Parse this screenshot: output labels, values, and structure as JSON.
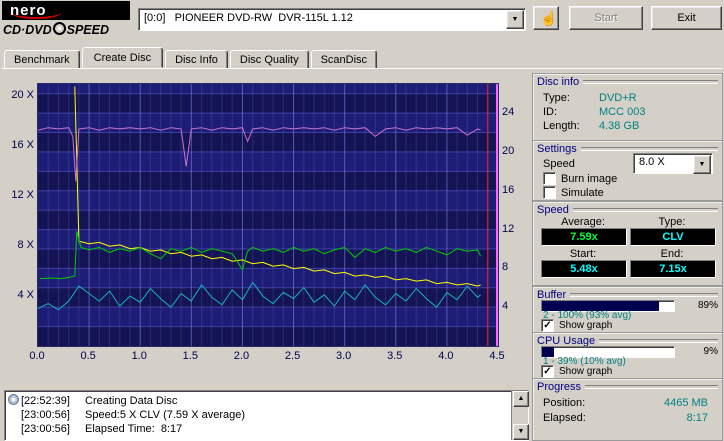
{
  "window": {
    "brand": {
      "logo_text": "nero",
      "logo_sub1": "CD·DVD",
      "logo_sub2": "SPEED"
    },
    "drive_selector": {
      "value": "[0:0]   PIONEER DVD-RW  DVR-115L 1.12"
    },
    "buttons": {
      "start": "Start",
      "exit": "Exit"
    }
  },
  "tabs": [
    {
      "label": "Benchmark"
    },
    {
      "label": "Create Disc"
    },
    {
      "label": "Disc Info"
    },
    {
      "label": "Disc Quality"
    },
    {
      "label": "ScanDisc"
    }
  ],
  "chart_data": {
    "type": "line",
    "xlim": [
      0,
      4.5
    ],
    "x_ticks": [
      {
        "v": 0.0,
        "label": "0.0"
      },
      {
        "v": 0.5,
        "label": "0.5"
      },
      {
        "v": 1.0,
        "label": "1.0"
      },
      {
        "v": 1.5,
        "label": "1.5"
      },
      {
        "v": 2.0,
        "label": "2.0"
      },
      {
        "v": 2.5,
        "label": "2.5"
      },
      {
        "v": 3.0,
        "label": "3.0"
      },
      {
        "v": 3.5,
        "label": "3.5"
      },
      {
        "v": 4.0,
        "label": "4.0"
      },
      {
        "v": 4.5,
        "label": "4.5"
      }
    ],
    "left_axis": {
      "max": 21,
      "ticks": [
        {
          "v": 20,
          "label": "20 X"
        },
        {
          "v": 16,
          "label": "16 X"
        },
        {
          "v": 12,
          "label": "12 X"
        },
        {
          "v": 8,
          "label": "8 X"
        },
        {
          "v": 4,
          "label": "4 X"
        }
      ]
    },
    "right_axis": {
      "max": 27,
      "ticks": [
        {
          "v": 24,
          "label": "24"
        },
        {
          "v": 20,
          "label": "20"
        },
        {
          "v": 16,
          "label": "16"
        },
        {
          "v": 12,
          "label": "12"
        },
        {
          "v": 8,
          "label": "8"
        },
        {
          "v": 4,
          "label": "4"
        }
      ]
    },
    "marker": {
      "x": 4.4,
      "color": "#ff2222"
    },
    "right_edge_color": "#ff66ff",
    "series": [
      {
        "name": "cpu-usage",
        "color": "#19b3b3",
        "points": [
          [
            0.0,
            3.0
          ],
          [
            0.1,
            3.4
          ],
          [
            0.2,
            2.9
          ],
          [
            0.3,
            3.6
          ],
          [
            0.4,
            4.8
          ],
          [
            0.5,
            4.2
          ],
          [
            0.6,
            3.6
          ],
          [
            0.7,
            4.4
          ],
          [
            0.8,
            3.2
          ],
          [
            0.9,
            4.0
          ],
          [
            1.0,
            3.5
          ],
          [
            1.1,
            4.6
          ],
          [
            1.2,
            3.8
          ],
          [
            1.3,
            3.1
          ],
          [
            1.4,
            4.2
          ],
          [
            1.5,
            3.6
          ],
          [
            1.6,
            4.9
          ],
          [
            1.7,
            3.9
          ],
          [
            1.8,
            3.3
          ],
          [
            1.9,
            4.5
          ],
          [
            2.0,
            3.7
          ],
          [
            2.1,
            5.1
          ],
          [
            2.2,
            4.0
          ],
          [
            2.3,
            3.4
          ],
          [
            2.4,
            4.3
          ],
          [
            2.5,
            3.8
          ],
          [
            2.6,
            4.7
          ],
          [
            2.7,
            3.5
          ],
          [
            2.8,
            4.1
          ],
          [
            2.9,
            3.2
          ],
          [
            3.0,
            4.4
          ],
          [
            3.1,
            3.7
          ],
          [
            3.2,
            4.9
          ],
          [
            3.3,
            3.9
          ],
          [
            3.4,
            3.3
          ],
          [
            3.5,
            4.2
          ],
          [
            3.6,
            3.6
          ],
          [
            3.7,
            4.6
          ],
          [
            3.8,
            3.8
          ],
          [
            3.9,
            3.1
          ],
          [
            4.0,
            4.3
          ],
          [
            4.1,
            3.7
          ],
          [
            4.2,
            4.8
          ],
          [
            4.3,
            3.9
          ],
          [
            4.33,
            4.1
          ]
        ]
      },
      {
        "name": "speed-secondary",
        "color": "#ffff00",
        "points": [
          [
            0.36,
            20.8
          ],
          [
            0.4,
            8.4
          ],
          [
            0.5,
            8.2
          ],
          [
            0.6,
            8.3
          ],
          [
            0.7,
            8.0
          ],
          [
            0.8,
            8.1
          ],
          [
            0.9,
            7.8
          ],
          [
            1.0,
            7.9
          ],
          [
            1.1,
            7.6
          ],
          [
            1.2,
            7.7
          ],
          [
            1.3,
            7.4
          ],
          [
            1.4,
            7.5
          ],
          [
            1.5,
            7.2
          ],
          [
            1.6,
            7.3
          ],
          [
            1.7,
            7.0
          ],
          [
            1.8,
            7.1
          ],
          [
            1.9,
            6.8
          ],
          [
            2.0,
            6.9
          ],
          [
            2.1,
            6.6
          ],
          [
            2.2,
            6.7
          ],
          [
            2.3,
            6.4
          ],
          [
            2.4,
            6.5
          ],
          [
            2.5,
            6.2
          ],
          [
            2.6,
            6.3
          ],
          [
            2.7,
            6.0
          ],
          [
            2.8,
            6.1
          ],
          [
            2.9,
            5.8
          ],
          [
            3.0,
            5.9
          ],
          [
            3.1,
            5.6
          ],
          [
            3.2,
            5.7
          ],
          [
            3.3,
            5.5
          ],
          [
            3.4,
            5.6
          ],
          [
            3.5,
            5.3
          ],
          [
            3.6,
            5.4
          ],
          [
            3.7,
            5.2
          ],
          [
            3.8,
            5.3
          ],
          [
            3.9,
            5.0
          ],
          [
            4.0,
            5.1
          ],
          [
            4.1,
            4.9
          ],
          [
            4.2,
            5.0
          ],
          [
            4.3,
            4.8
          ],
          [
            4.33,
            4.9
          ]
        ]
      },
      {
        "name": "write-speed",
        "color": "#00cc00",
        "points": [
          [
            0.02,
            5.4
          ],
          [
            0.12,
            5.45
          ],
          [
            0.22,
            5.4
          ],
          [
            0.3,
            5.5
          ],
          [
            0.36,
            5.6
          ],
          [
            0.38,
            9.2
          ],
          [
            0.42,
            7.9
          ],
          [
            0.5,
            7.7
          ],
          [
            0.6,
            7.9
          ],
          [
            0.7,
            7.5
          ],
          [
            0.8,
            7.8
          ],
          [
            0.9,
            7.6
          ],
          [
            1.0,
            7.9
          ],
          [
            1.1,
            7.4
          ],
          [
            1.2,
            7.0
          ],
          [
            1.3,
            7.8
          ],
          [
            1.4,
            7.6
          ],
          [
            1.5,
            7.9
          ],
          [
            1.6,
            7.5
          ],
          [
            1.7,
            7.8
          ],
          [
            1.8,
            7.6
          ],
          [
            1.9,
            7.4
          ],
          [
            1.95,
            6.8
          ],
          [
            2.0,
            6.1
          ],
          [
            2.05,
            7.6
          ],
          [
            2.1,
            7.9
          ],
          [
            2.2,
            7.6
          ],
          [
            2.3,
            7.8
          ],
          [
            2.4,
            7.5
          ],
          [
            2.5,
            7.9
          ],
          [
            2.6,
            7.6
          ],
          [
            2.7,
            7.8
          ],
          [
            2.8,
            7.4
          ],
          [
            2.9,
            7.7
          ],
          [
            3.0,
            7.9
          ],
          [
            3.1,
            7.1
          ],
          [
            3.2,
            7.8
          ],
          [
            3.3,
            7.5
          ],
          [
            3.4,
            7.9
          ],
          [
            3.5,
            7.6
          ],
          [
            3.6,
            7.8
          ],
          [
            3.7,
            7.5
          ],
          [
            3.8,
            7.9
          ],
          [
            3.9,
            7.6
          ],
          [
            4.0,
            7.3
          ],
          [
            4.1,
            7.8
          ],
          [
            4.2,
            7.6
          ],
          [
            4.3,
            7.7
          ],
          [
            4.33,
            7.2
          ]
        ]
      },
      {
        "name": "buffer-level",
        "color": "#c975c9",
        "points": [
          [
            0.0,
            17.3
          ],
          [
            0.1,
            17.5
          ],
          [
            0.2,
            17.4
          ],
          [
            0.3,
            17.5
          ],
          [
            0.34,
            16.8
          ],
          [
            0.37,
            13.2
          ],
          [
            0.4,
            17.4
          ],
          [
            0.5,
            17.5
          ],
          [
            0.6,
            17.3
          ],
          [
            0.7,
            17.5
          ],
          [
            0.8,
            17.4
          ],
          [
            0.9,
            17.5
          ],
          [
            1.0,
            17.4
          ],
          [
            1.1,
            17.5
          ],
          [
            1.2,
            17.3
          ],
          [
            1.3,
            17.5
          ],
          [
            1.4,
            17.4
          ],
          [
            1.45,
            14.4
          ],
          [
            1.5,
            17.4
          ],
          [
            1.6,
            17.5
          ],
          [
            1.7,
            17.3
          ],
          [
            1.8,
            17.5
          ],
          [
            1.9,
            17.4
          ],
          [
            2.0,
            17.5
          ],
          [
            2.05,
            16.4
          ],
          [
            2.1,
            17.4
          ],
          [
            2.2,
            17.5
          ],
          [
            2.3,
            17.3
          ],
          [
            2.4,
            17.5
          ],
          [
            2.5,
            17.4
          ],
          [
            2.6,
            17.5
          ],
          [
            2.7,
            17.4
          ],
          [
            2.8,
            17.5
          ],
          [
            2.9,
            17.3
          ],
          [
            3.0,
            17.5
          ],
          [
            3.1,
            17.4
          ],
          [
            3.2,
            17.5
          ],
          [
            3.3,
            16.8
          ],
          [
            3.4,
            17.4
          ],
          [
            3.5,
            17.5
          ],
          [
            3.6,
            17.3
          ],
          [
            3.7,
            17.5
          ],
          [
            3.8,
            17.4
          ],
          [
            3.9,
            17.5
          ],
          [
            4.0,
            17.4
          ],
          [
            4.1,
            17.5
          ],
          [
            4.2,
            16.9
          ],
          [
            4.3,
            17.4
          ],
          [
            4.33,
            17.3
          ]
        ]
      }
    ]
  },
  "log": {
    "lines": [
      {
        "time": "[22:52:39]",
        "text": "Creating Data Disc"
      },
      {
        "time": "[23:00:56]",
        "text": "Speed:5 X CLV (7.59 X average)"
      },
      {
        "time": "[23:00:56]",
        "text": "Elapsed Time:  8:17"
      }
    ]
  },
  "panels": {
    "disc_info": {
      "title": "Disc info",
      "rows": [
        {
          "label": "Type:",
          "value": "DVD+R"
        },
        {
          "label": "ID:",
          "value": "MCC 003"
        },
        {
          "label": "Length:",
          "value": "4.38 GB"
        }
      ]
    },
    "settings": {
      "title": "Settings",
      "speed_label": "Speed",
      "speed_value": "8.0 X",
      "checkboxes": [
        {
          "label": "Burn image",
          "check": ""
        },
        {
          "label": "Simulate",
          "check": ""
        }
      ]
    },
    "speed": {
      "title": "Speed",
      "average_label": "Average:",
      "average_value": "7.59x",
      "type_label": "Type:",
      "type_value": "CLV",
      "start_label": "Start:",
      "start_value": "5.48x",
      "end_label": "End:",
      "end_value": "7.15x"
    },
    "buffer": {
      "title": "Buffer",
      "fill": 89,
      "percent": "89%",
      "range_text": "2 - 100% (93% avg)",
      "show_graph": "Show graph",
      "check": "✓"
    },
    "cpu": {
      "title": "CPU Usage",
      "fill": 9,
      "percent": "9%",
      "range_text": "1 - 39% (10% avg)",
      "show_graph": "Show graph",
      "check": "✓"
    },
    "progress": {
      "title": "Progress",
      "position_label": "Position:",
      "position_value": "4465 MB",
      "elapsed_label": "Elapsed:",
      "elapsed_value": "8:17"
    }
  }
}
